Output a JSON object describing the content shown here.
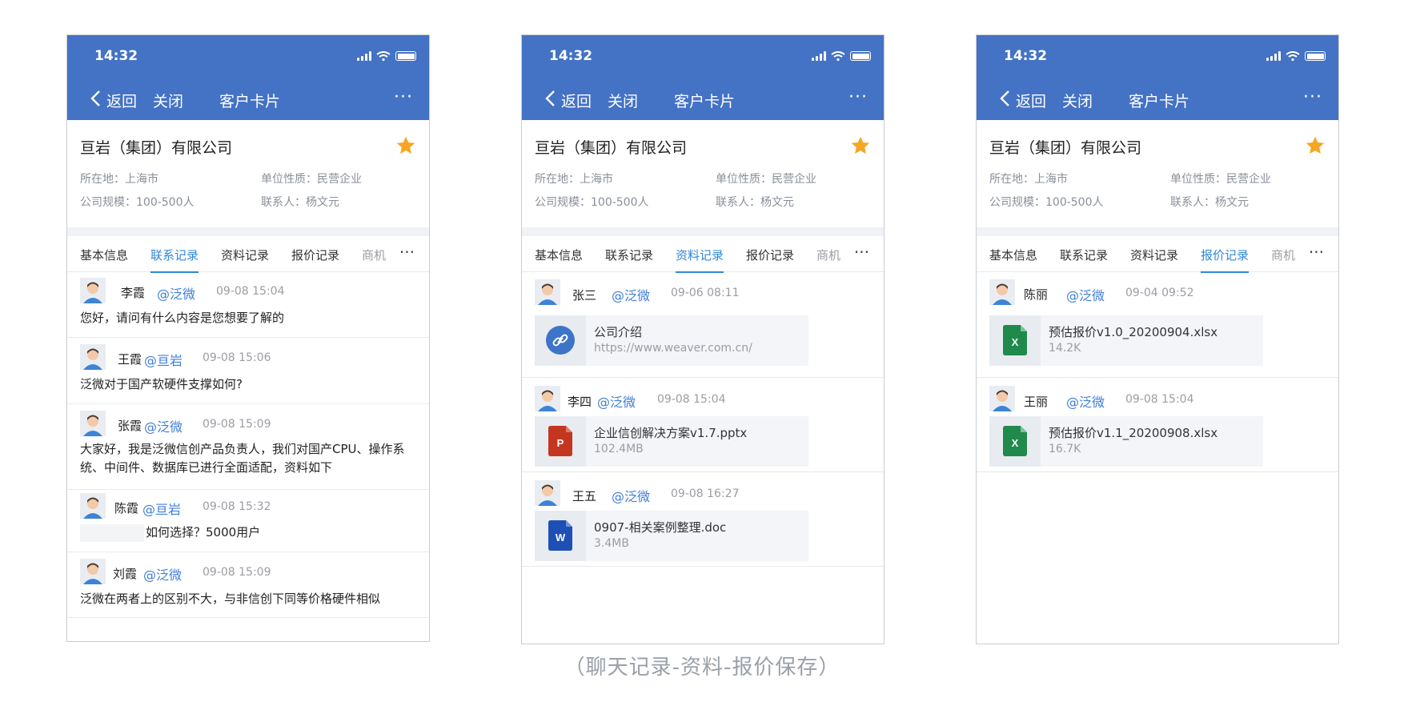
{
  "common": {
    "time": "14:32",
    "back": "返回",
    "close": "关闭",
    "title": "客户卡片",
    "more": "···",
    "company_name": "亘岩（集团）有限公司",
    "location": "所在地：上海市",
    "nature": "单位性质：民营企业",
    "scale": "公司规模：100-500人",
    "contact": "联系人：杨文元",
    "tabs": [
      "基本信息",
      "联系记录",
      "资料记录",
      "报价记录",
      "商机"
    ],
    "accent_color": "#4472c4",
    "star_color": "#f5a623"
  },
  "screen1": {
    "active_tab": "联系记录",
    "messages": [
      {
        "user": "李霞",
        "mention": "@泛微",
        "time": "09-08 15:04",
        "text": "您好，请问有什么内容是您想要了解的"
      },
      {
        "user": "王霞",
        "mention": "@亘岩",
        "time": "09-08 15:06",
        "text": "泛微对于国产软硬件支撑如何?"
      },
      {
        "user": "张霞",
        "mention": "@泛微",
        "time": "09-08 15:09",
        "text": "大家好，我是泛微信创产品负责人，我们对国产CPU、操作系统、中间件、数据库已进行全面适配，资料如下"
      },
      {
        "user": "陈霞",
        "mention": "@亘岩",
        "time": "09-08 15:32",
        "text": "如何选择？5000用户"
      },
      {
        "user": "刘霞",
        "mention": "@泛微",
        "time": "09-08 15:09",
        "text": "泛微在两者上的区别不大，与非信创下同等价格硬件相似"
      }
    ]
  },
  "screen2": {
    "active_tab": "资料记录",
    "items": [
      {
        "user": "张三",
        "mention": "@泛微",
        "time": "09-06 08:11",
        "file": "公司介绍",
        "sub": "https://www.weaver.com.cn/",
        "icon": "link-icon"
      },
      {
        "user": "李四",
        "mention": "@泛微",
        "time": "09-08 15:04",
        "file": "企业信创解决方案v1.7.pptx",
        "sub": "102.4MB",
        "icon": "ppt-icon"
      },
      {
        "user": "王五",
        "mention": "@泛微",
        "time": "09-08 16:27",
        "file": "0907-相关案例整理.doc",
        "sub": "3.4MB",
        "icon": "word-icon"
      }
    ]
  },
  "screen3": {
    "active_tab": "报价记录",
    "items": [
      {
        "user": "陈丽",
        "mention": "@泛微",
        "time": "09-04 09:52",
        "file": "预估报价v1.0_20200904.xlsx",
        "sub": "14.2K",
        "icon": "excel-icon"
      },
      {
        "user": "王丽",
        "mention": "@泛微",
        "time": "09-08 15:04",
        "file": "预估报价v1.1_20200908.xlsx",
        "sub": "16.7K",
        "icon": "excel-icon"
      }
    ]
  },
  "caption": "（聊天记录-资料-报价保存）"
}
